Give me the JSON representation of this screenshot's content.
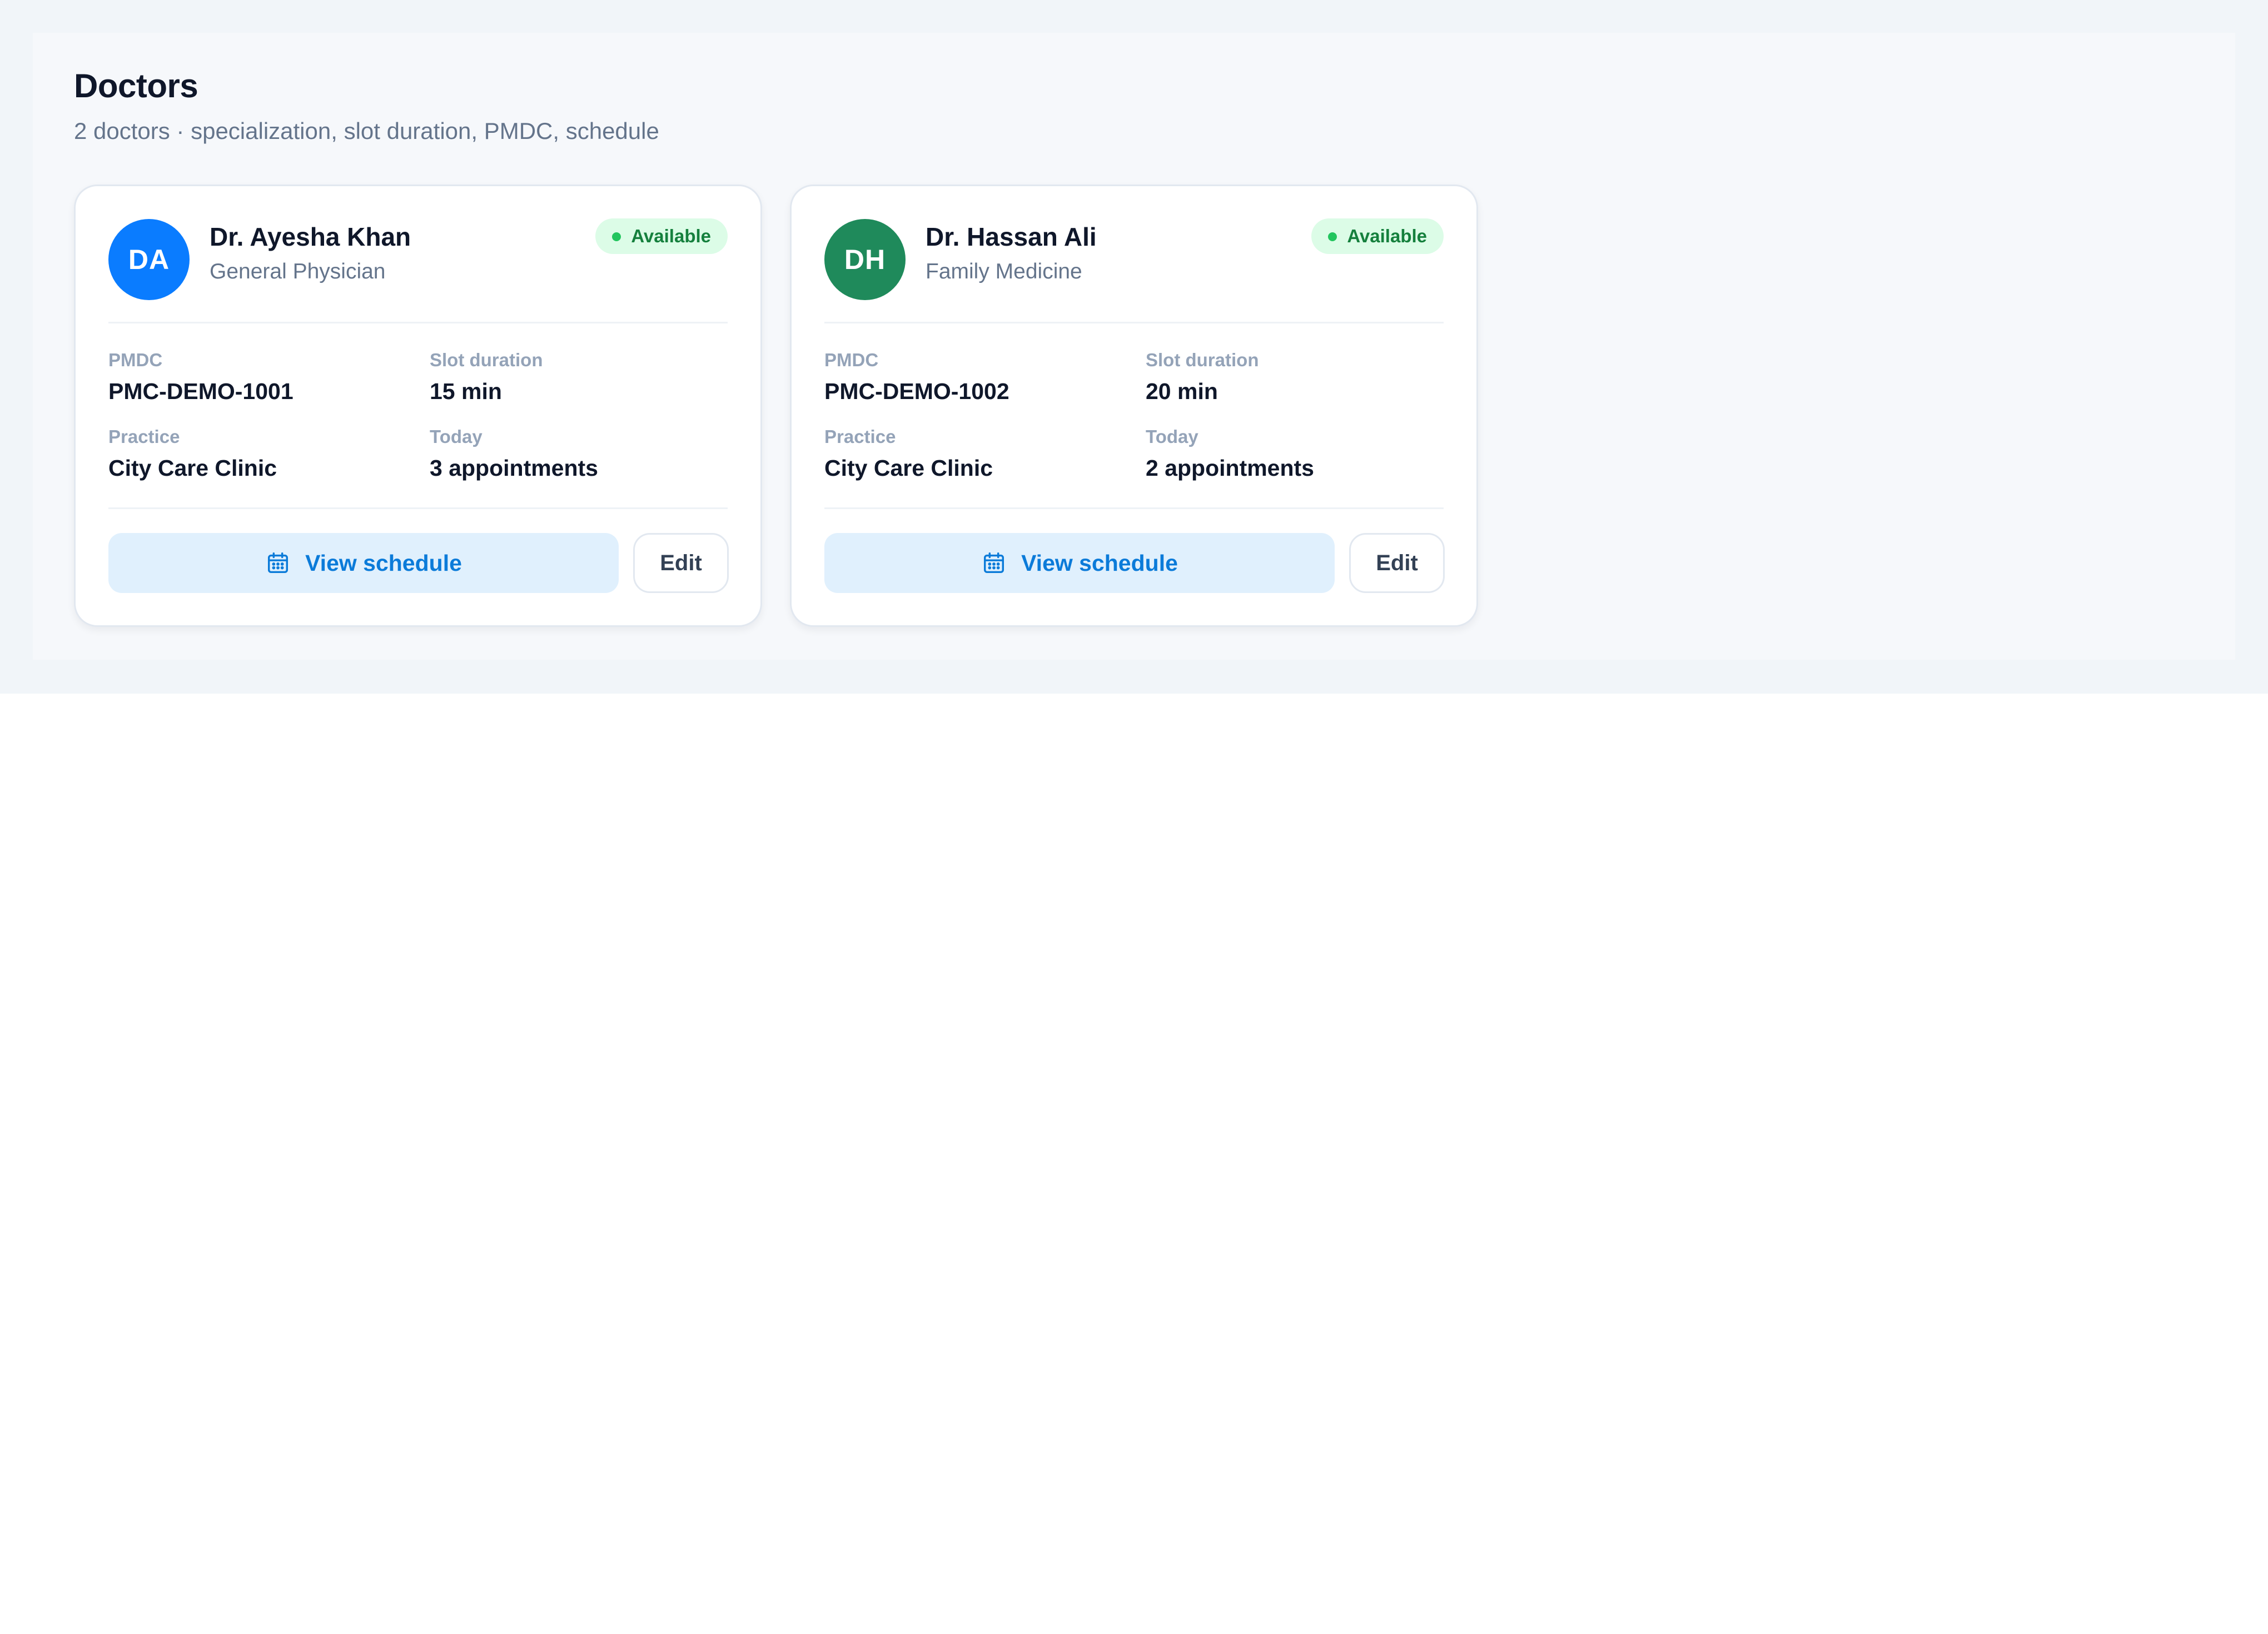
{
  "header": {
    "title": "Doctors",
    "subtitle": "2 doctors · specialization, slot duration, PMDC, schedule"
  },
  "labels": {
    "pmdc": "PMDC",
    "slot_duration": "Slot duration",
    "practice": "Practice",
    "today": "Today",
    "view_schedule": "View schedule",
    "edit": "Edit"
  },
  "doctors": [
    {
      "initials": "DA",
      "name": "Dr. Ayesha Khan",
      "specialization": "General Physician",
      "status": "Available",
      "pmdc": "PMC-DEMO-1001",
      "slot_duration": "15 min",
      "practice": "City Care Clinic",
      "today": "3 appointments",
      "avatar_color": "#0a7cff"
    },
    {
      "initials": "DH",
      "name": "Dr. Hassan Ali",
      "specialization": "Family Medicine",
      "status": "Available",
      "pmdc": "PMC-DEMO-1002",
      "slot_duration": "20 min",
      "practice": "City Care Clinic",
      "today": "2 appointments",
      "avatar_color": "#1f8a5b"
    }
  ],
  "colors": {
    "status_bg": "#dcfce7",
    "status_text": "#15803d",
    "status_dot": "#22c55e",
    "primary_action_bg": "#e0f0fd",
    "primary_action_text": "#0b7bd9"
  },
  "icons": {
    "schedule_button": "calendar-icon",
    "status": "status-dot-icon"
  }
}
